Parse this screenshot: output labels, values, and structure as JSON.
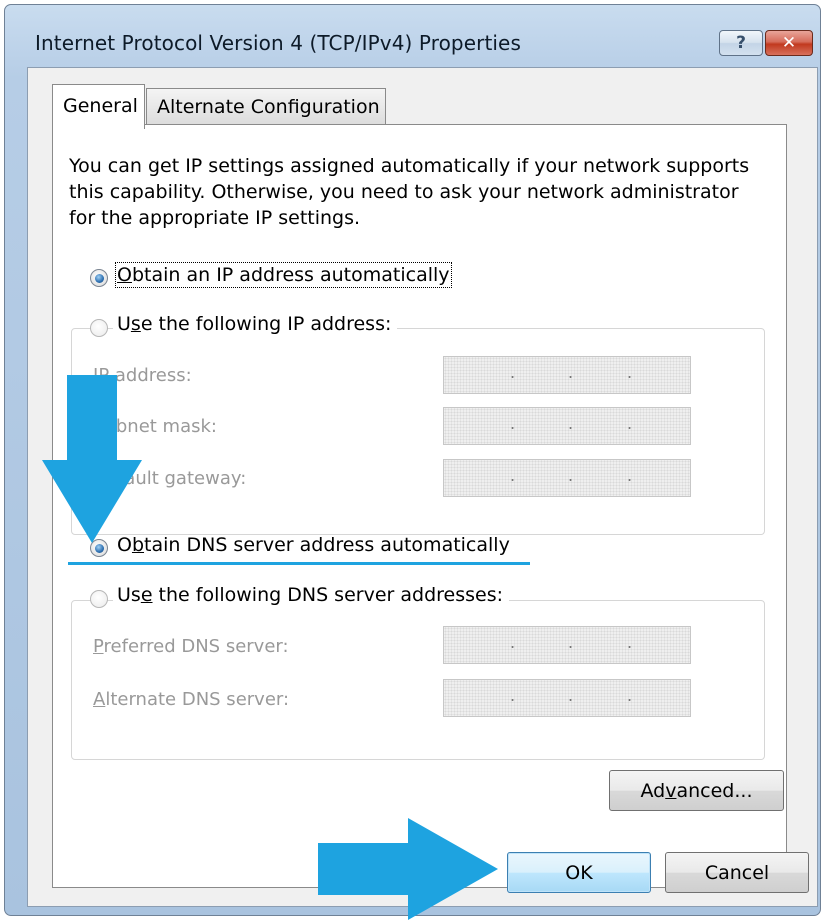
{
  "window": {
    "title": "Internet Protocol Version 4 (TCP/IPv4) Properties",
    "help_glyph": "?",
    "close_glyph": "✕"
  },
  "tabs": [
    {
      "label": "General",
      "selected": true
    },
    {
      "label": "Alternate Configuration",
      "selected": false
    }
  ],
  "intro_text": "You can get IP settings assigned automatically if your network supports this capability. Otherwise, you need to ask your network administrator for the appropriate IP settings.",
  "ip_section": {
    "auto_option": {
      "pre": "",
      "accel": "O",
      "post": "btain an IP address automatically",
      "selected": true
    },
    "manual_option": {
      "pre": "U",
      "accel": "s",
      "post": "e the following IP address:",
      "selected": false
    },
    "fields": [
      {
        "pre": "",
        "accel": "I",
        "post": "P address:",
        "dots": [
          ".",
          ".",
          "."
        ]
      },
      {
        "pre": "S",
        "accel": "u",
        "post": "bnet mask:",
        "dots": [
          ".",
          ".",
          "."
        ]
      },
      {
        "pre": "",
        "accel": "D",
        "post": "efault gateway:",
        "dots": [
          ".",
          ".",
          "."
        ]
      }
    ]
  },
  "dns_section": {
    "auto_option": {
      "pre": "O",
      "accel": "b",
      "post": "tain DNS server address automatically",
      "selected": true
    },
    "manual_option": {
      "pre": "Us",
      "accel": "e",
      "post": " the following DNS server addresses:",
      "selected": false
    },
    "fields": [
      {
        "pre": "",
        "accel": "P",
        "post": "referred DNS server:",
        "dots": [
          ".",
          ".",
          "."
        ]
      },
      {
        "pre": "",
        "accel": "A",
        "post": "lternate DNS server:",
        "dots": [
          ".",
          ".",
          "."
        ]
      }
    ]
  },
  "buttons": {
    "advanced": {
      "pre": "Ad",
      "accel": "v",
      "post": "anced..."
    },
    "ok": "OK",
    "cancel": "Cancel"
  },
  "colors": {
    "annotation_arrow": "#1ea3e0",
    "titlebar": "#b6cde6",
    "close_button": "#c1391f"
  }
}
